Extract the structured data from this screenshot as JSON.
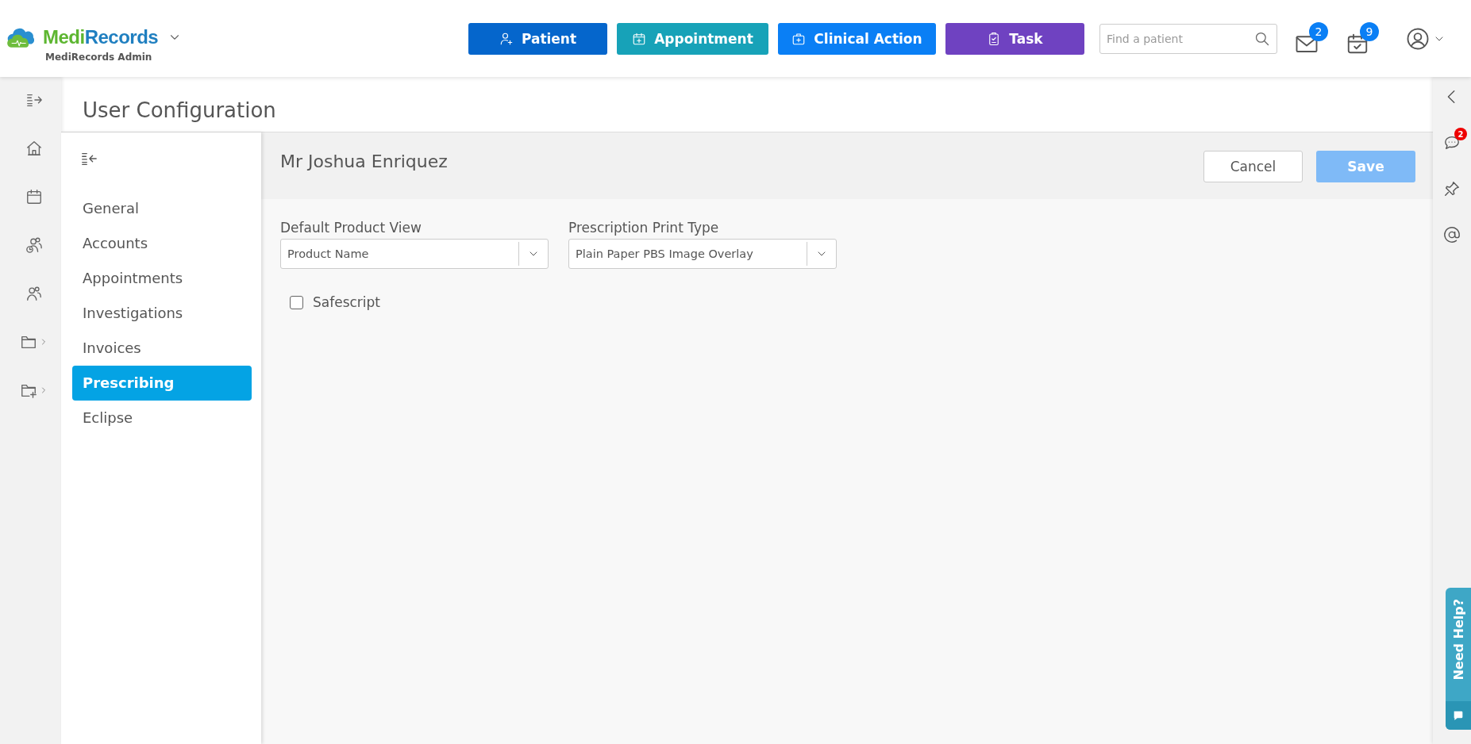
{
  "brand": {
    "name_part1": "Medi",
    "name_part2": "Records",
    "subtitle": "MediRecords Admin"
  },
  "header_buttons": [
    {
      "label": "Patient",
      "kind": "patient",
      "color": "#0566cc"
    },
    {
      "label": "Appointment",
      "kind": "appointment",
      "color": "#17a2b8"
    },
    {
      "label": "Clinical Action",
      "kind": "clinical",
      "color": "#0a7ff5"
    },
    {
      "label": "Task",
      "kind": "task",
      "color": "#6f42c1"
    }
  ],
  "search": {
    "placeholder": "Find a patient"
  },
  "notifications": {
    "mail_count": "2",
    "calendar_count": "9"
  },
  "page_title": "User Configuration",
  "settings_nav": [
    {
      "label": "General",
      "selected": false
    },
    {
      "label": "Accounts",
      "selected": false
    },
    {
      "label": "Appointments",
      "selected": false
    },
    {
      "label": "Investigations",
      "selected": false
    },
    {
      "label": "Invoices",
      "selected": false
    },
    {
      "label": "Prescribing",
      "selected": true
    },
    {
      "label": "Eclipse",
      "selected": false
    }
  ],
  "user_name": "Mr Joshua Enriquez",
  "actions": [
    {
      "label": "Cancel",
      "kind": "secondary",
      "disabled": false
    },
    {
      "label": "Save",
      "kind": "primary",
      "disabled": true
    }
  ],
  "fields": [
    {
      "label": "Default Product View",
      "value": "Product Name"
    },
    {
      "label": "Prescription Print Type",
      "value": "Plain Paper PBS Image Overlay"
    }
  ],
  "checkbox": {
    "label": "Safescript",
    "checked": false
  },
  "right_rail": {
    "chat_count": "2"
  },
  "help": {
    "label": "Need Help?"
  }
}
